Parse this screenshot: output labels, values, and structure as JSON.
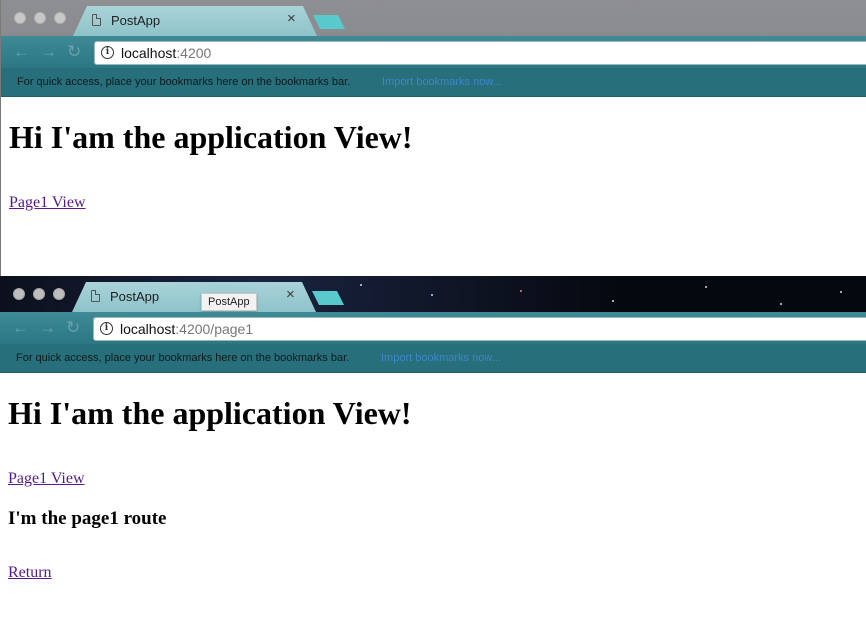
{
  "windows": [
    {
      "tab": {
        "title": "PostApp",
        "close": "×"
      },
      "address": {
        "host": "localhost",
        "rest": ":4200"
      },
      "bookmarks": {
        "text": "For quick access, place your bookmarks here on the bookmarks bar.",
        "import_link": "Import bookmarks now..."
      },
      "page": {
        "heading": "Hi I'am the application View!",
        "link": "Page1 View"
      }
    },
    {
      "tab": {
        "title": "PostApp",
        "close": "×",
        "tooltip": "PostApp"
      },
      "address": {
        "host": "localhost",
        "rest": ":4200/page1"
      },
      "bookmarks": {
        "text": "For quick access, place your bookmarks here on the bookmarks bar.",
        "import_link": "Import bookmarks now..."
      },
      "page": {
        "heading": "Hi I'am the application View!",
        "link": "Page1 View",
        "route_text": "I'm the page1 route",
        "return_link": "Return"
      }
    }
  ],
  "icons": {
    "back": "←",
    "forward": "→",
    "reload": "↻",
    "info": "i"
  }
}
